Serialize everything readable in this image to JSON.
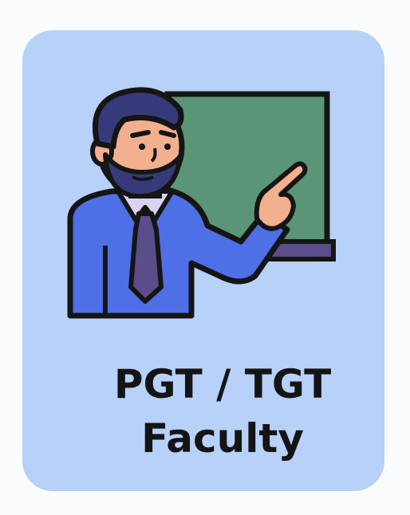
{
  "card": {
    "title_line1": "PGT / TGT",
    "title_line2": "Faculty",
    "icon": "teacher-at-board-icon",
    "colors": {
      "card_background": "#b7d1f8",
      "board": "#5a9577",
      "board_frame": "#151515",
      "shirt": "#4f6fe6",
      "tie": "#5b4c8a",
      "skin": "#f2b08f",
      "hair": "#373a7a",
      "text": "#141414"
    }
  }
}
